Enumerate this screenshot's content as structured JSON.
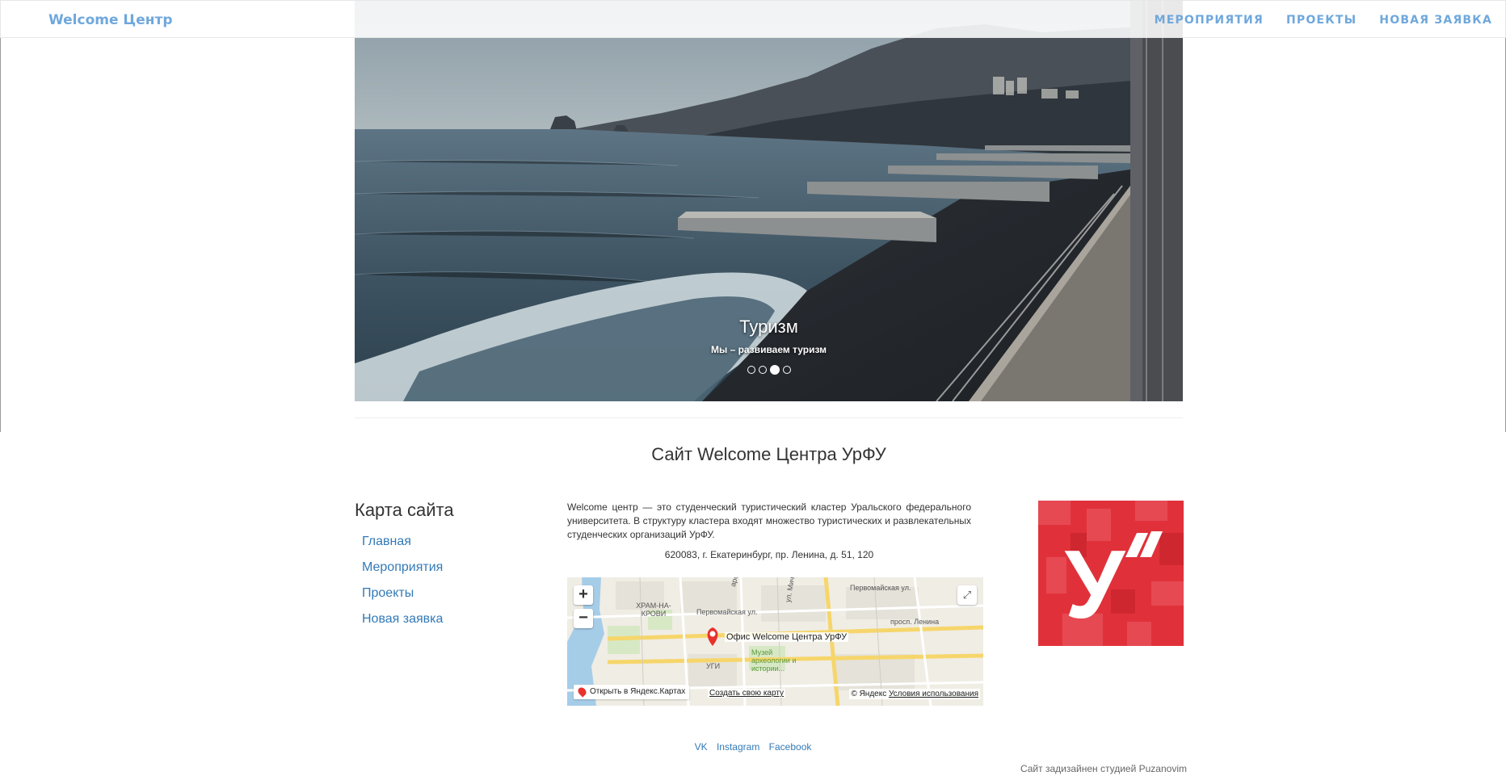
{
  "navbar": {
    "brand": "Welcome Центр",
    "links": [
      "МЕРОПРИЯТИЯ",
      "ПРОЕКТЫ",
      "НОВАЯ ЗАЯВКА"
    ],
    "link_color": "#6fa8dc"
  },
  "carousel": {
    "slide_title": "Туризм",
    "slide_text": "Мы – развиваем туризм",
    "indicator_count": 4,
    "active_index": 2
  },
  "main": {
    "site_title": "Сайт Welcome Центра УрФУ"
  },
  "sitemap": {
    "title": "Карта сайта",
    "items": [
      "Главная",
      "Мероприятия",
      "Проекты",
      "Новая заявка"
    ]
  },
  "about": {
    "text": "Welcome центр — это студенческий туристический кластер Уральского федерального университета. В структуру кластера входят множество туристических и развлекательных студенческих организаций УрФУ.",
    "address": "620083, г. Екатеринбург, пр. Ленина, д. 51, 120"
  },
  "map": {
    "zoom_in": "+",
    "zoom_out": "−",
    "marker_label": "Офис Welcome Центра УрФУ",
    "streets": [
      "Первомайская ул.",
      "Первомайская ул.",
      "просп. Ленина",
      "ул. Мичурина",
      "ХРАМ-НА-КРОВИ",
      "Музей археологии и истории...",
      "УГИ",
      "арского"
    ],
    "open_link": "Открыть в Яндекс.Картах",
    "create_link": "Создать свою карту",
    "copyright": "© Яндекс",
    "terms": "Условия использования",
    "marker_color": "#e8322c"
  },
  "logo": {
    "letter": "У",
    "brand_color": "#e0313a"
  },
  "footer": {
    "social": [
      "VK",
      "Instagram",
      "Facebook"
    ],
    "credit": "Сайт задизайнен студией Puzanovim"
  }
}
